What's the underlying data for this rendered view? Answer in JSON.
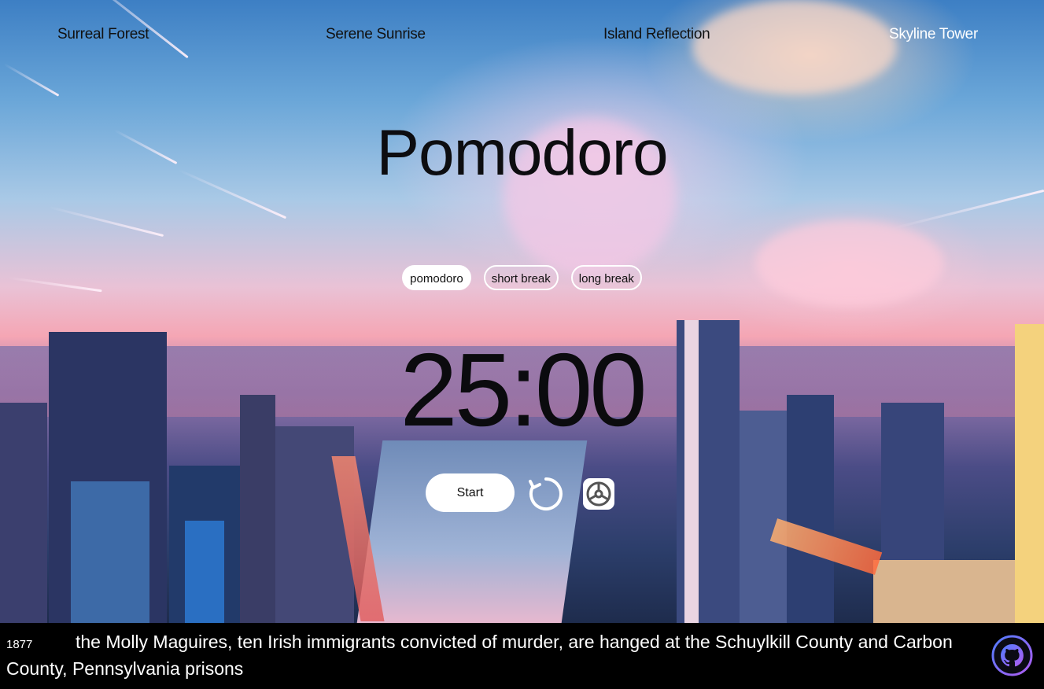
{
  "nav": {
    "items": [
      {
        "label": "Surreal Forest",
        "color": "#111111"
      },
      {
        "label": "Serene Sunrise",
        "color": "#111111"
      },
      {
        "label": "Island Reflection",
        "color": "#111111"
      },
      {
        "label": "Skyline Tower",
        "color": "#ffffff"
      }
    ]
  },
  "app": {
    "title": "Pomodoro"
  },
  "modes": [
    {
      "label": "pomodoro",
      "active": true
    },
    {
      "label": "short break",
      "active": false
    },
    {
      "label": "long break",
      "active": false
    }
  ],
  "timer": {
    "display": "25:00"
  },
  "controls": {
    "start_label": "Start",
    "reset_icon": "reset-icon",
    "settings_icon": "settings-icon"
  },
  "footer": {
    "year": "1877",
    "event": "the Molly Maguires, ten Irish immigrants convicted of murder, are hanged at the Schuylkill County and Carbon County, Pennsylvania prisons",
    "github_icon": "github-icon"
  },
  "colors": {
    "accent_white": "#ffffff",
    "footer_bg": "#000000",
    "github_ring": "#8a5cf6"
  }
}
